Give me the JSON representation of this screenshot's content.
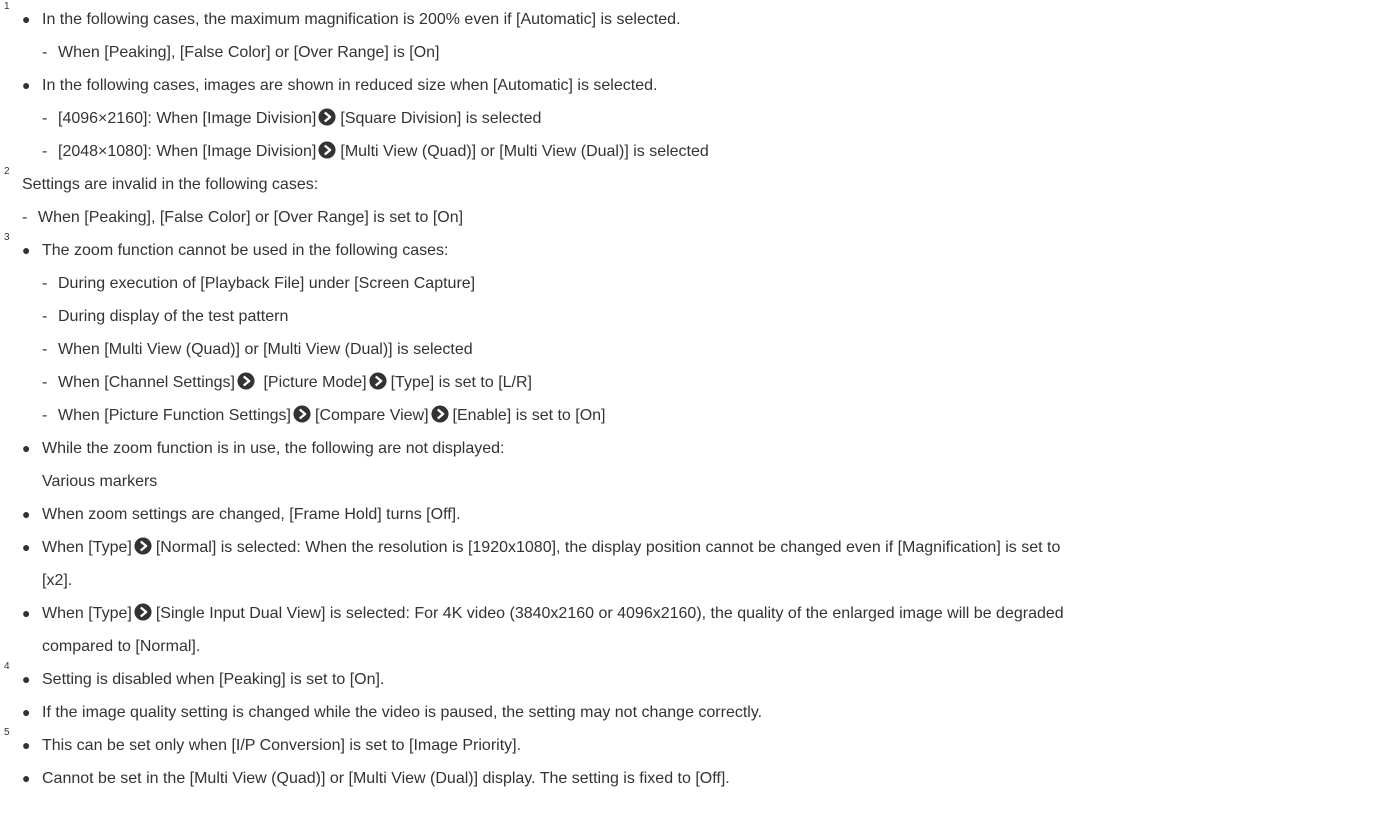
{
  "colors": {
    "text": "#333333",
    "background": "#ffffff"
  },
  "icons": {
    "arrow": "right-arrow-circle-icon"
  },
  "notes": {
    "n1": "1",
    "n2": "2",
    "n3": "3",
    "n4": "4",
    "n5": "5"
  },
  "lines": {
    "l1": "In the following cases, the maximum magnification is 200% even if [Automatic] is selected.",
    "l2": "When [Peaking], [False Color] or [Over Range] is [On]",
    "l3": "In the following cases, images are shown in reduced size when [Automatic] is selected.",
    "l4a": "[4096×2160]: When [Image Division]",
    "l4b": "[Square Division] is selected",
    "l5a": "[2048×1080]: When [Image Division]",
    "l5b": "[Multi View (Quad)] or [Multi View (Dual)] is selected",
    "l6": "Settings are invalid in the following cases:",
    "l7": "When [Peaking], [False Color] or [Over Range] is set to [On]",
    "l8": "The zoom function cannot be used in the following cases:",
    "l9": "During execution of [Playback File] under [Screen Capture]",
    "l10": "During display of the test pattern",
    "l11": "When [Multi View (Quad)] or [Multi View (Dual)] is selected",
    "l12a": "When [Channel Settings]",
    "l12b": " [Picture Mode]",
    "l12c": "[Type] is set to [L/R]",
    "l13a": "When [Picture Function Settings]",
    "l13b": "[Compare View]",
    "l13c": "[Enable] is set to [On]",
    "l14": "While the zoom function is in use, the following are not displayed:",
    "l15": "Various markers",
    "l16": "When zoom settings are changed, [Frame Hold] turns [Off].",
    "l17a": "When [Type]",
    "l17b": "[Normal] is selected: When the resolution is [1920x1080], the display position cannot be changed even if [Magnification] is set to",
    "l18": "[x2].",
    "l19a": "When [Type]",
    "l19b": "[Single Input Dual View] is selected: For 4K video (3840x2160 or 4096x2160), the quality of the enlarged image will be degraded",
    "l20": "compared to [Normal].",
    "l21": "Setting is disabled when [Peaking] is set to [On].",
    "l22": "If the image quality setting is changed while the video is paused, the setting may not change correctly.",
    "l23": "This can be set only when [I/P Conversion] is set to [Image Priority].",
    "l24": "Cannot be set in the [Multi View (Quad)] or [Multi View (Dual)] display. The setting is fixed to [Off]."
  }
}
